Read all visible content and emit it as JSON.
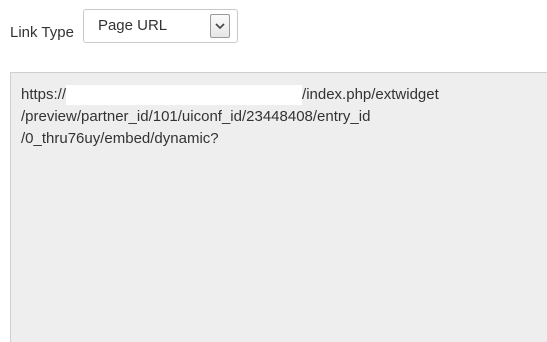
{
  "link_type": {
    "label": "Link Type",
    "selected_value": "Page URL",
    "arrow_icon": "chevron-down-icon"
  },
  "url_box": {
    "line1_prefix": "https://",
    "line1_suffix": "/index.php/extwidget",
    "line2": "/preview/partner_id/101/uiconf_id/23448408/entry_id",
    "line3": "/0_thru76uy/embed/dynamic?"
  },
  "colors": {
    "text": "#333333",
    "textarea_bg": "#eeeeee",
    "border": "#c9c9c9",
    "redaction": "#ffffff"
  }
}
